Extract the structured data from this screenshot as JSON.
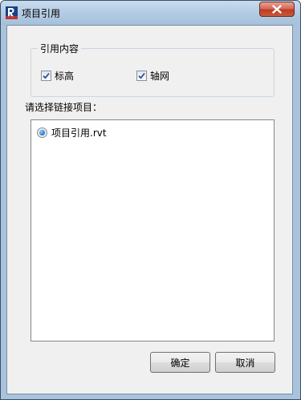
{
  "window": {
    "title": "项目引用",
    "icon": "revit-app-icon",
    "close_icon": "close-icon"
  },
  "group": {
    "label": "引用内容",
    "options": [
      {
        "label": "标高",
        "checked": true
      },
      {
        "label": "轴网",
        "checked": true
      }
    ]
  },
  "list": {
    "label": "请选择链接项目：",
    "items": [
      {
        "label": "项目引用.rvt",
        "selected": true
      }
    ]
  },
  "buttons": {
    "ok_label": "确定",
    "cancel_label": "取消"
  },
  "colors": {
    "titlebar": "#b3cbe4",
    "close_button": "#c9503a",
    "dialog_background": "#f0f0f0",
    "radio_selected": "#2a7fd0"
  }
}
